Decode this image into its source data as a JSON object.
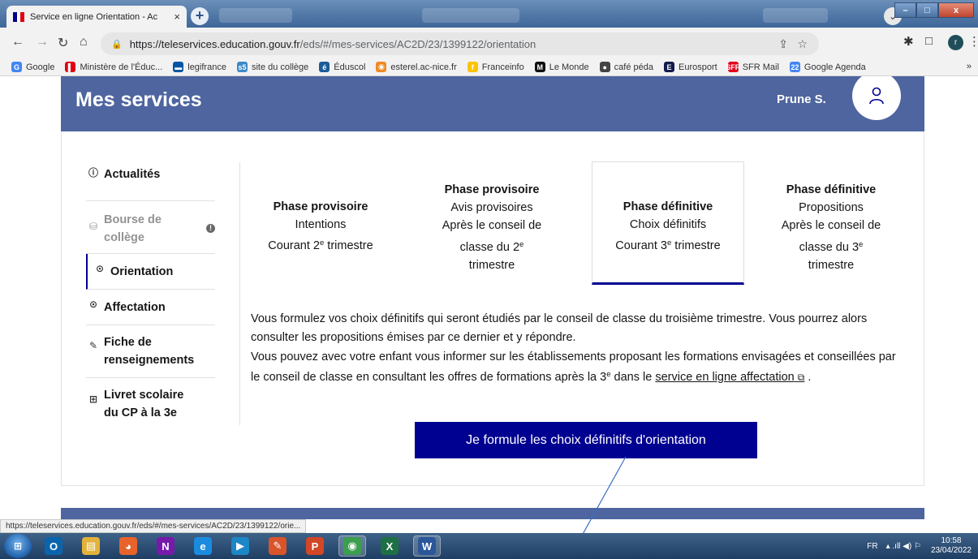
{
  "browser": {
    "tab_title": "Service en ligne Orientation - Ac",
    "tab_close": "×",
    "newtab": "+",
    "tab_search": "⌄",
    "url_host": "https://teleservices.education.gouv.fr",
    "url_path": "/eds/#/mes-services/AC2D/23/1399122/orientation",
    "profile_initial": "r",
    "window_buttons": {
      "minimize": "–",
      "maximize": "□",
      "close": "x"
    },
    "bookmarks": [
      {
        "label": "Google",
        "icon": "G",
        "color": "#4285f4"
      },
      {
        "label": "Ministère de l'Éduc...",
        "icon": "▌",
        "color": "#e1000f"
      },
      {
        "label": "legifrance",
        "icon": "▬",
        "color": "#0055a4"
      },
      {
        "label": "site du collège",
        "icon": "s5",
        "color": "#3d8ac7"
      },
      {
        "label": "Éduscol",
        "icon": "é",
        "color": "#1b5b9a"
      },
      {
        "label": "esterel.ac-nice.fr",
        "icon": "◉",
        "color": "#f08a24"
      },
      {
        "label": "Franceinfo",
        "icon": "f",
        "color": "#fcc400"
      },
      {
        "label": "Le Monde",
        "icon": "M",
        "color": "#111111"
      },
      {
        "label": "café péda",
        "icon": "●",
        "color": "#444444"
      },
      {
        "label": "Eurosport",
        "icon": "E",
        "color": "#141b4d"
      },
      {
        "label": "SFR Mail",
        "icon": "SFR",
        "color": "#e2001a"
      },
      {
        "label": "Google Agenda",
        "icon": "22",
        "color": "#4285f4"
      }
    ],
    "bookmarks_more": "»"
  },
  "header": {
    "title": "Mes services",
    "user_name": "Prune S."
  },
  "menu": {
    "items": [
      {
        "label": "Actualités",
        "icon": "ⓘ"
      },
      {
        "label": "Bourse de collège",
        "icon": "⛁",
        "info": "!"
      },
      {
        "label": "Orientation",
        "icon": "⊙"
      },
      {
        "label": "Affectation",
        "icon": "⊙"
      },
      {
        "label": "Fiche de renseignements",
        "icon": "✎"
      },
      {
        "label": "Livret scolaire du CP à la 3e",
        "icon": "⊞"
      }
    ]
  },
  "phases": [
    {
      "title": "Phase provisoire",
      "line1": "Intentions",
      "line2a": "Courant 2",
      "sup": "e",
      "line2b": " trimestre"
    },
    {
      "title": "Phase provisoire",
      "line1": "Avis provisoires",
      "line2": "Après le conseil de",
      "line3a": "classe du 2",
      "sup": "e",
      "line4": "trimestre"
    },
    {
      "title": "Phase définitive",
      "line1": "Choix définitifs",
      "line2a": "Courant 3",
      "sup": "e",
      "line2b": " trimestre"
    },
    {
      "title": "Phase définitive",
      "line1": "Propositions",
      "line2": "Après le conseil de",
      "line3a": "classe du 3",
      "sup": "e",
      "line4": "trimestre"
    }
  ],
  "description": {
    "p1": "Vous formulez vos choix définitifs qui seront étudiés par le conseil de classe du troisième trimestre. Vous pourrez alors consulter les propositions émises par ce dernier et y répondre.",
    "p2a": "Vous pouvez avec votre enfant vous informer sur les établissements proposant les formations envisagées et conseillées par le conseil de classe en consultant les offres de formations après la 3",
    "p2sup": "e",
    "p2b": " dans le ",
    "link": "service en ligne affectation",
    "link_icon": "⧉",
    "p2end": " ."
  },
  "cta_label": "Je formule les choix définitifs d'orientation",
  "status_url": "https://teleservices.education.gouv.fr/eds/#/mes-services/AC2D/23/1399122/orie...",
  "taskbar": {
    "start": "⊞",
    "apps": [
      {
        "name": "outlook",
        "label": "O",
        "color": "#0a64ad"
      },
      {
        "name": "explorer",
        "label": "▤",
        "color": "#e2b23a"
      },
      {
        "name": "firefox",
        "label": "◕",
        "color": "#e8632b"
      },
      {
        "name": "onenote",
        "label": "N",
        "color": "#7719aa"
      },
      {
        "name": "ie",
        "label": "e",
        "color": "#1b8be0"
      },
      {
        "name": "media",
        "label": "▶",
        "color": "#1d87c6"
      },
      {
        "name": "paint",
        "label": "✎",
        "color": "#d9542b"
      },
      {
        "name": "powerpoint",
        "label": "P",
        "color": "#d24726"
      },
      {
        "name": "chrome",
        "label": "◉",
        "color": "#3c9e4f"
      },
      {
        "name": "excel",
        "label": "X",
        "color": "#1d7044"
      },
      {
        "name": "word",
        "label": "W",
        "color": "#2b579a"
      }
    ],
    "lang": "FR",
    "tray_icons": "▴  .ıll  ◀)  ⚐",
    "time": "10:58",
    "date": "23/04/2022"
  }
}
